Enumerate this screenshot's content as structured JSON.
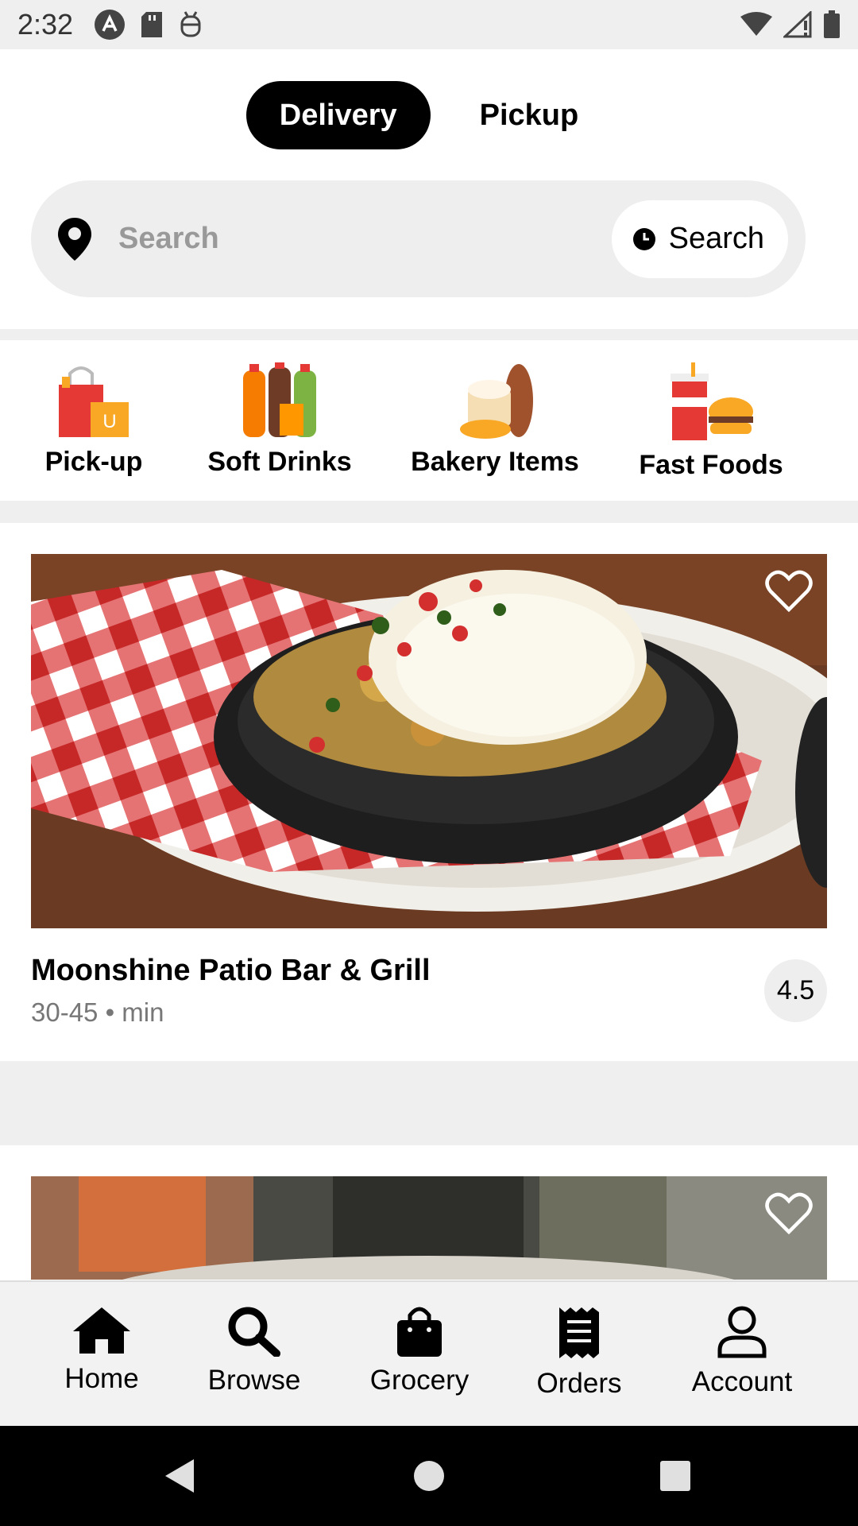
{
  "status_bar": {
    "time": "2:32",
    "left_icons": [
      "app-a-icon",
      "sd-card-icon",
      "android-debug-icon"
    ],
    "right_icons": [
      "wifi-icon",
      "cell-signal-icon",
      "battery-icon"
    ]
  },
  "mode_toggle": {
    "delivery_label": "Delivery",
    "pickup_label": "Pickup",
    "selected": "Delivery"
  },
  "search": {
    "location_icon": "location-pin-icon",
    "placeholder": "Search",
    "schedule_button_label": "Search",
    "schedule_icon": "clock-icon"
  },
  "categories": [
    {
      "label": "Pick-up",
      "icon": "shopping-bags-icon"
    },
    {
      "label": "Soft Drinks",
      "icon": "soft-drinks-icon"
    },
    {
      "label": "Bakery Items",
      "icon": "bakery-icon"
    },
    {
      "label": "Fast Foods",
      "icon": "fast-food-icon"
    }
  ],
  "restaurants": [
    {
      "name": "Moonshine Patio Bar & Grill",
      "meta": "30-45 • min",
      "rating": "4.5",
      "favorite_icon": "heart-outline-icon"
    },
    {
      "favorite_icon": "heart-outline-icon"
    }
  ],
  "bottom_nav": [
    {
      "label": "Home",
      "icon": "home-icon"
    },
    {
      "label": "Browse",
      "icon": "search-icon"
    },
    {
      "label": "Grocery",
      "icon": "shopping-bag-icon"
    },
    {
      "label": "Orders",
      "icon": "receipt-icon"
    },
    {
      "label": "Account",
      "icon": "person-icon"
    }
  ],
  "system_nav": [
    "back-icon",
    "home-circle-icon",
    "recents-icon"
  ],
  "colors": {
    "accent": "#000000",
    "background_band": "#efefef",
    "search_background": "#eeeeee",
    "muted_text": "#777777"
  }
}
